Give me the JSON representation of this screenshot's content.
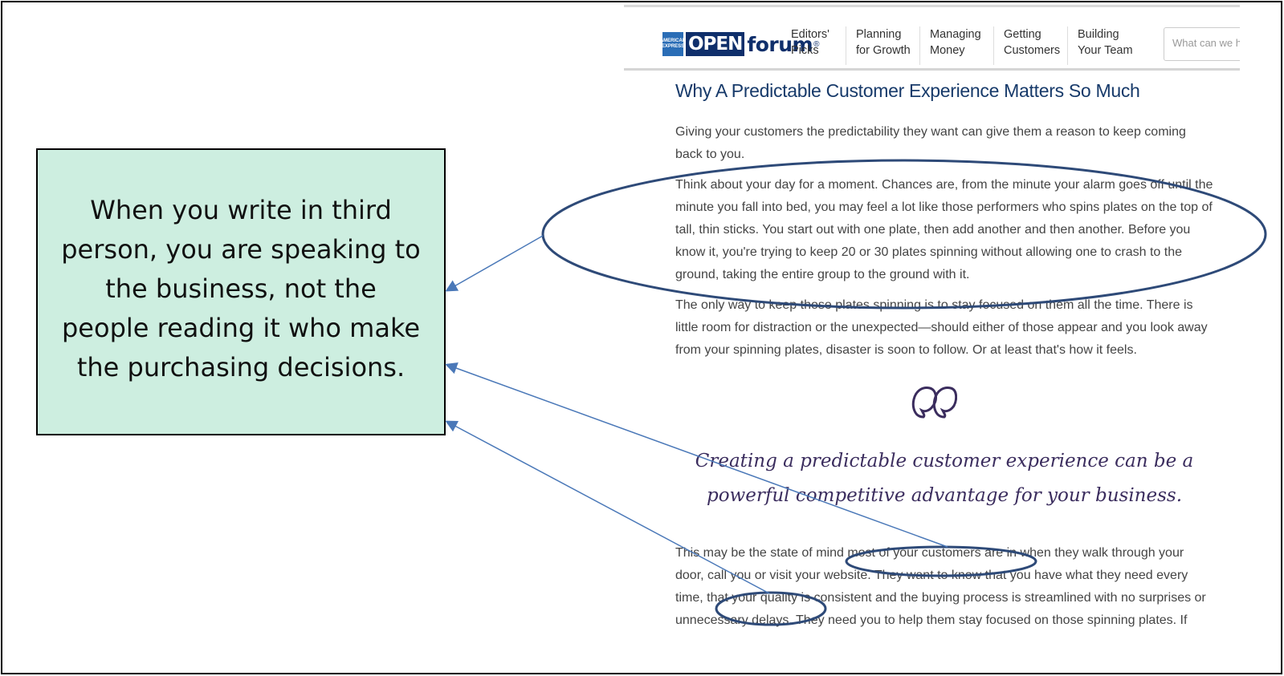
{
  "callout": {
    "text": "When you write in third person, you are speaking to the business, not the people reading it who make the purchasing decisions."
  },
  "site": {
    "logo": {
      "amex_text": "AMERICAN EXPRESS",
      "open_text": "OPEN",
      "forum_text": "forum",
      "reg_mark": "®"
    },
    "nav": [
      {
        "line1": "Editors'",
        "line2": "Picks"
      },
      {
        "line1": "Planning",
        "line2": "for Growth"
      },
      {
        "line1": "Managing",
        "line2": "Money"
      },
      {
        "line1": "Getting",
        "line2": "Customers"
      },
      {
        "line1": "Building",
        "line2": "Your Team"
      }
    ],
    "search_placeholder": "What can we h"
  },
  "article": {
    "title": "Why A Predictable Customer Experience Matters So Much",
    "paragraphs": [
      "Giving your customers the predictability they want can give them a reason to keep coming back to you.",
      "Think about your day for a moment. Chances are, from the minute your alarm goes off until the minute you fall into bed, you may feel a lot like those performers who spins plates on the top of tall, thin sticks. You start out with one plate, then add another and then another. Before you know it, you're trying to keep 20 or 30 plates spinning without allowing one to crash to the ground, taking the entire group to the ground with it.",
      "The only way to keep those plates spinning is to stay focused on them all the time. There is little room for distraction or the unexpected—should either of those appear and you look away from your spinning plates, disaster is soon to follow. Or at least that's how it feels.",
      "This may be the state of mind most of your customers are in when they walk through your door, call you or visit your website. They want to know that you have what they need every time, that your quality is consistent and the buying process is streamlined with no surprises or unnecessary delays. They need you to help them stay focused on those spinning plates. If"
    ],
    "pull_quote": "Creating a predictable customer experience can be a powerful competitive advantage for your business."
  },
  "colors": {
    "callout_bg": "#cdeee0",
    "annotation": "#2e4a78",
    "arrow": "#4a78b8"
  }
}
